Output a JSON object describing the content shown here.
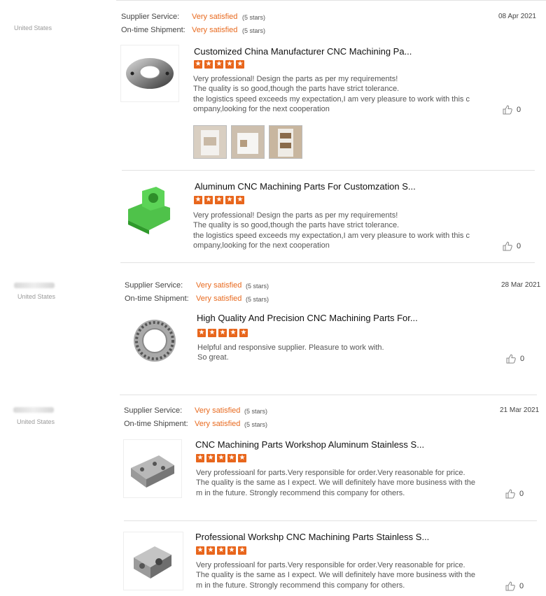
{
  "reviews": [
    {
      "country": "United States",
      "supplier_label": "Supplier Service:",
      "supplier_value": "Very satisfied",
      "supplier_stars": "(5 stars)",
      "shipment_label": "On-time Shipment:",
      "shipment_value": "Very satisfied",
      "shipment_stars": "(5 stars)",
      "date": "08 Apr 2021",
      "items": [
        {
          "title": "Customized China Manufacturer CNC Machining Pa...",
          "lines": [
            "Very professional! Design the parts as per my requirements!",
            "The quality is so good,though the parts have strict tolerance.",
            "the logistics speed exceeds my expectation,I am very pleasure to work with this c",
            "ompany,looking for the next cooperation"
          ],
          "likes": "0"
        },
        {
          "title": "Aluminum CNC Machining Parts For Customzation S...",
          "lines": [
            "Very professional! Design the parts as per my requirements!",
            "The quality is so good,though the parts have strict tolerance.",
            "the logistics speed exceeds my expectation,I am very pleasure to work with this c",
            "ompany,looking for the next cooperation"
          ],
          "likes": "0"
        }
      ]
    },
    {
      "country": "United States",
      "supplier_label": "Supplier Service:",
      "supplier_value": "Very satisfied",
      "supplier_stars": "(5 stars)",
      "shipment_label": "On-time Shipment:",
      "shipment_value": "Very satisfied",
      "shipment_stars": "(5 stars)",
      "date": "28 Mar 2021",
      "items": [
        {
          "title": "High Quality And Precision CNC Machining Parts For...",
          "lines": [
            "Helpful and responsive supplier. Pleasure to work with.",
            "So great."
          ],
          "likes": "0"
        }
      ]
    },
    {
      "country": "United States",
      "supplier_label": "Supplier Service:",
      "supplier_value": "Very satisfied",
      "supplier_stars": "(5 stars)",
      "shipment_label": "On-time Shipment:",
      "shipment_value": "Very satisfied",
      "shipment_stars": "(5 stars)",
      "date": "21 Mar 2021",
      "items": [
        {
          "title": "CNC Machining Parts Workshop Aluminum Stainless S...",
          "lines": [
            "Very professioanl for parts.Very responsible for order.Very reasonable for price.",
            "The quality is the same as I expect. We will definitely have more business with the",
            "m in the future. Strongly recommend this company for others."
          ],
          "likes": "0"
        },
        {
          "title": "Professional Workshp CNC Machining Parts Stainless S...",
          "lines": [
            "Very professioanl for parts.Very responsible for order.Very reasonable for price.",
            "The quality is the same as I expect. We will definitely have more business with the",
            "m in the future. Strongly recommend this company for others."
          ],
          "likes": "0"
        }
      ]
    }
  ],
  "rating": 5,
  "colors": {
    "accent": "#e86a1f",
    "star_bg": "#e8661c",
    "divider": "#e2e2e2"
  }
}
